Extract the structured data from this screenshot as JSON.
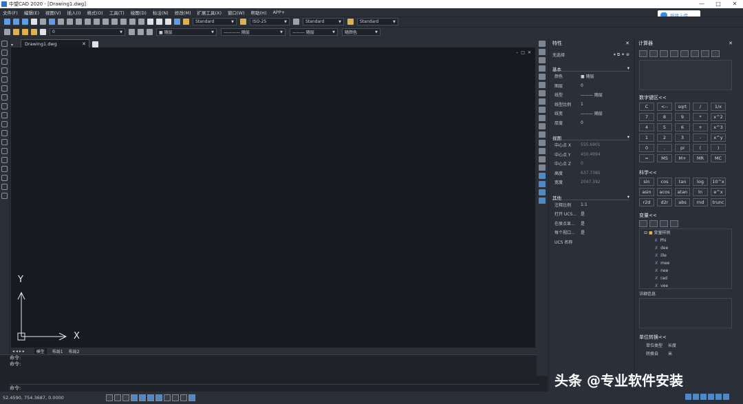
{
  "titlebar": {
    "title": "中望CAD 2020 - [Drawing1.dwg]",
    "min": "—",
    "max": "□",
    "close": "✕"
  },
  "menu": [
    "文件(F)",
    "编辑(E)",
    "视图(V)",
    "插入(I)",
    "格式(O)",
    "工具(T)",
    "绘图(D)",
    "标注(N)",
    "修改(M)",
    "扩展工具(X)",
    "窗口(W)",
    "帮助(H)",
    "APP+"
  ],
  "cloud_label": "拖拽上传",
  "toolbar": {
    "text_style": "Standard",
    "dim_style": "ISO-25",
    "table_style": "Standard",
    "multileader_style": "Standard",
    "layer": "0",
    "color": "随层",
    "linetype": "随层",
    "lineweight": "随层",
    "plot_style": "随颜色"
  },
  "doc_tab": {
    "name": "Drawing1.dwg",
    "close": "✕"
  },
  "ucs": {
    "x": "X",
    "y": "Y"
  },
  "layout_tabs": [
    "模型",
    "布局1",
    "布局2"
  ],
  "cmd": {
    "lines": [
      "命令:",
      "命令:"
    ],
    "prompt": "命令:"
  },
  "status": {
    "coords": "52.4590, 754.3687, 0.0000"
  },
  "properties": {
    "title": "特性",
    "selection": "无选择",
    "sections": [
      {
        "name": "基本",
        "rows": [
          {
            "k": "颜色",
            "v": "■ 随层"
          },
          {
            "k": "图层",
            "v": "0"
          },
          {
            "k": "线型",
            "v": "——— 随层"
          },
          {
            "k": "线型比例",
            "v": "1"
          },
          {
            "k": "线宽",
            "v": "——— 随层"
          },
          {
            "k": "厚度",
            "v": "0"
          }
        ]
      },
      {
        "name": "视图",
        "rows": [
          {
            "k": "中心点 X",
            "v": "555.6901"
          },
          {
            "k": "中心点 Y",
            "v": "450.4994"
          },
          {
            "k": "中心点 Z",
            "v": "0"
          },
          {
            "k": "高度",
            "v": "637.7385"
          },
          {
            "k": "宽度",
            "v": "2047.392"
          }
        ]
      },
      {
        "name": "其他",
        "rows": [
          {
            "k": "注释比例",
            "v": "1:1"
          },
          {
            "k": "打开 UCS...",
            "v": "是"
          },
          {
            "k": "在原点显...",
            "v": "是"
          },
          {
            "k": "每个视口...",
            "v": "是"
          },
          {
            "k": "UCS 名称",
            "v": ""
          }
        ]
      }
    ]
  },
  "calculator": {
    "title": "计算器",
    "numpad_title": "数字键区<<",
    "numpad": [
      "C",
      "<--",
      "sqrt",
      "/",
      "1/x",
      "7",
      "8",
      "9",
      "*",
      "x^2",
      "4",
      "5",
      "6",
      "+",
      "x^3",
      "1",
      "2",
      "3",
      "-",
      "x^y",
      "0",
      ".",
      "pi",
      "(",
      ")",
      "=",
      "MS",
      "M+",
      "MR",
      "MC"
    ],
    "sci_title": "科学<<",
    "sci": [
      "sin",
      "cos",
      "tan",
      "log",
      "10^x",
      "asin",
      "acos",
      "atan",
      "ln",
      "e^x",
      "r2d",
      "d2r",
      "abs",
      "rnd",
      "trunc"
    ],
    "var_title": "变量<<",
    "var_root": "变量样例",
    "vars": [
      {
        "t": "k",
        "n": "Phi"
      },
      {
        "t": "X",
        "n": "dee"
      },
      {
        "t": "X",
        "n": "ille"
      },
      {
        "t": "X",
        "n": "mee"
      },
      {
        "t": "X",
        "n": "nee"
      },
      {
        "t": "X",
        "n": "rad"
      },
      {
        "t": "X",
        "n": "vee"
      }
    ],
    "detail_title": "详细信息",
    "unit_title": "单位转换<<",
    "unit_rows": [
      {
        "k": "单位类型",
        "v": "长度"
      },
      {
        "k": "转换自",
        "v": "米"
      }
    ]
  },
  "watermark": "头条 @专业软件安装"
}
